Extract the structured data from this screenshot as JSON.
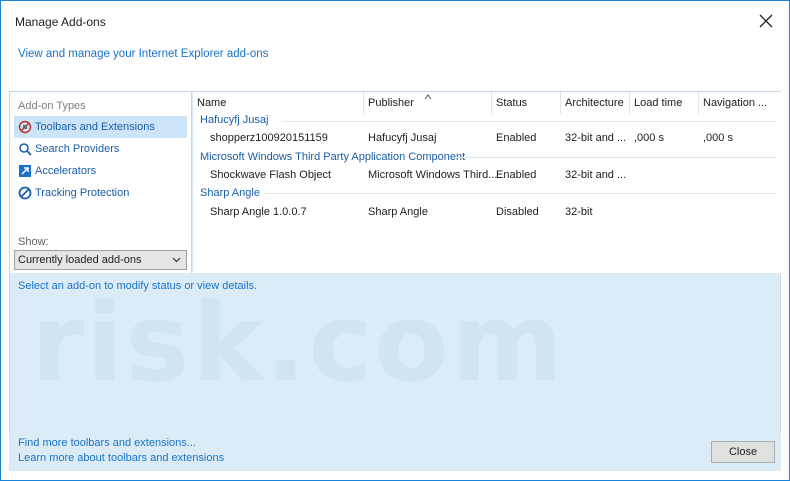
{
  "window": {
    "title": "Manage Add-ons",
    "subtitle": "View and manage your Internet Explorer add-ons"
  },
  "sidebar": {
    "types_label": "Add-on Types",
    "items": [
      {
        "label": "Toolbars and Extensions",
        "icon": "toolbar-extension-icon",
        "selected": true
      },
      {
        "label": "Search Providers",
        "icon": "search-icon",
        "selected": false
      },
      {
        "label": "Accelerators",
        "icon": "accelerator-icon",
        "selected": false
      },
      {
        "label": "Tracking Protection",
        "icon": "no-entry-icon",
        "selected": false
      }
    ],
    "show_label": "Show:",
    "show_value": "Currently loaded add-ons"
  },
  "table": {
    "columns": [
      "Name",
      "Publisher",
      "Status",
      "Architecture",
      "Load time",
      "Navigation ..."
    ],
    "groups": [
      {
        "title": "Hafucyfj Jusaj",
        "rows": [
          [
            "shopperz100920151159",
            "Hafucyfj Jusaj",
            "Enabled",
            "32-bit and ...",
            ",000 s",
            ",000 s"
          ]
        ]
      },
      {
        "title": "Microsoft Windows Third Party Application Component",
        "rows": [
          [
            "Shockwave Flash Object",
            "Microsoft Windows Third...",
            "Enabled",
            "32-bit and ...",
            "",
            ""
          ]
        ]
      },
      {
        "title": "Sharp Angle",
        "rows": [
          [
            "Sharp Angle 1.0.0.7",
            "Sharp Angle",
            "Disabled",
            "32-bit",
            "",
            ""
          ]
        ]
      }
    ]
  },
  "status": {
    "text": "Select an add-on to modify status or view details."
  },
  "footer": {
    "link1": "Find more toolbars and extensions...",
    "link2": "Learn more about toolbars and extensions",
    "close_label": "Close"
  },
  "watermark": {
    "text": "risk.com"
  },
  "colors": {
    "accent": "#1883d7",
    "link": "#1a73c8",
    "selection": "#cce4f7",
    "details_bg": "#dcecf7"
  }
}
